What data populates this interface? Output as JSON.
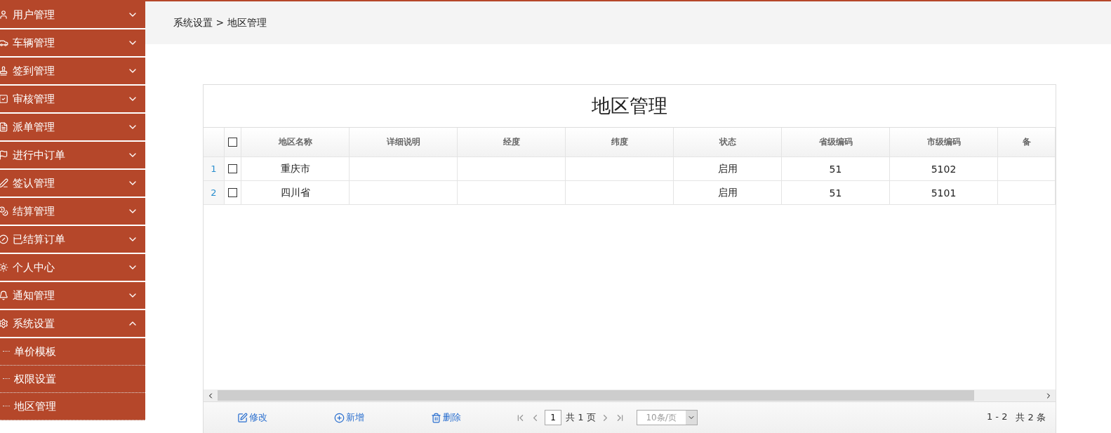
{
  "sidebar": {
    "groups": [
      {
        "label": "用户管理",
        "expanded": false
      },
      {
        "label": "车辆管理",
        "expanded": false
      },
      {
        "label": "签到管理",
        "expanded": false
      },
      {
        "label": "审核管理",
        "expanded": false
      },
      {
        "label": "派单管理",
        "expanded": false
      },
      {
        "label": "进行中订单",
        "expanded": false
      },
      {
        "label": "签认管理",
        "expanded": false
      },
      {
        "label": "结算管理",
        "expanded": false
      },
      {
        "label": "已结算订单",
        "expanded": false
      },
      {
        "label": "个人中心",
        "expanded": false
      },
      {
        "label": "通知管理",
        "expanded": false
      },
      {
        "label": "系统设置",
        "expanded": true,
        "children": [
          {
            "label": "单价模板"
          },
          {
            "label": "权限设置"
          },
          {
            "label": "地区管理"
          }
        ]
      }
    ]
  },
  "breadcrumb": "系统设置 > 地区管理",
  "panel": {
    "title": "地区管理",
    "table": {
      "select_all": false,
      "columns": [
        "地区名称",
        "详细说明",
        "经度",
        "纬度",
        "状态",
        "省级编码",
        "市级编码",
        "备"
      ],
      "rows": [
        {
          "index": "1",
          "checked": false,
          "cells": [
            "重庆市",
            "",
            "",
            "",
            "启用",
            "51",
            "5102",
            ""
          ]
        },
        {
          "index": "2",
          "checked": false,
          "cells": [
            "四川省",
            "",
            "",
            "",
            "启用",
            "51",
            "5101",
            ""
          ]
        }
      ]
    },
    "actions": [
      {
        "kind": "edit",
        "label": "修改"
      },
      {
        "kind": "add",
        "label": "新增"
      },
      {
        "kind": "delete",
        "label": "删除"
      }
    ],
    "pager": {
      "page": "1",
      "total_pages": "共 1 页",
      "page_size": "10条/页",
      "range": "1 - 2",
      "total": "共 2 条"
    }
  }
}
